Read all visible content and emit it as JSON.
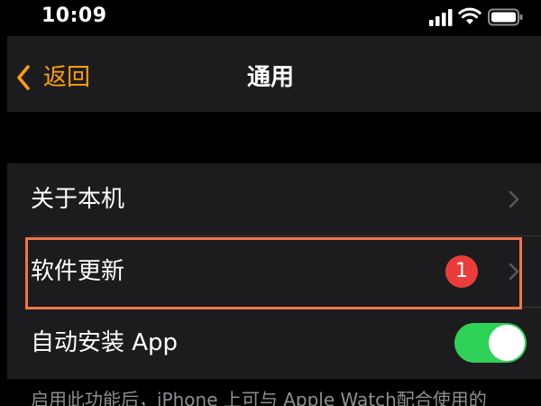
{
  "status_bar": {
    "time": "10:09"
  },
  "nav": {
    "back_label": "返回",
    "title": "通用"
  },
  "list": {
    "about": {
      "label": "关于本机"
    },
    "software_update": {
      "label": "软件更新",
      "badge": "1"
    },
    "auto_install": {
      "label": "自动安装 App",
      "toggle_on": true
    }
  },
  "footnote": "启用此功能后，iPhone 上可与 Apple Watch配合使用的",
  "colors": {
    "accent": "#ff9f0a",
    "toggle_on": "#30d158",
    "badge": "#ea3d3a",
    "highlight": "#f0744a"
  }
}
